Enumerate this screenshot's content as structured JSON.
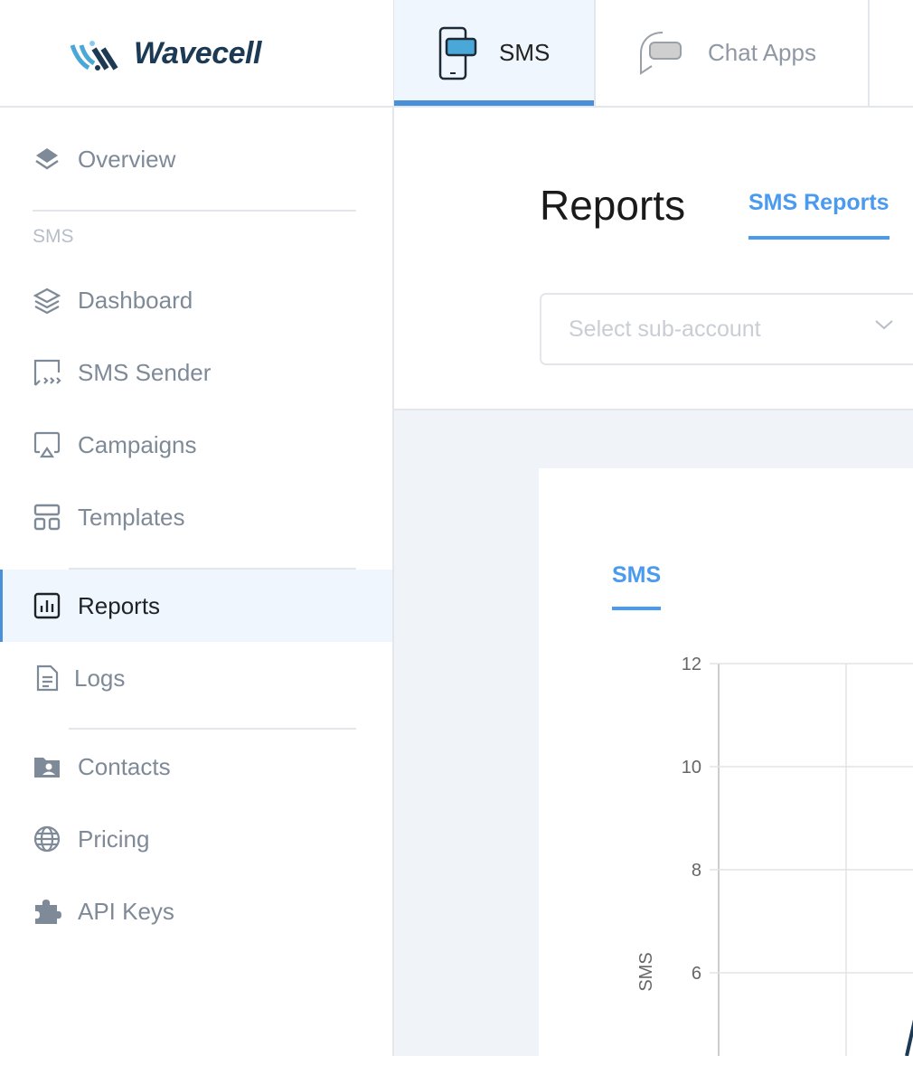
{
  "header": {
    "logo_text": "Wavecell",
    "tabs": [
      {
        "label": "SMS",
        "icon": "phone-message-icon",
        "active": true
      },
      {
        "label": "Chat Apps",
        "icon": "chat-bubbles-icon",
        "active": false
      }
    ]
  },
  "sidebar": {
    "overview": {
      "label": "Overview",
      "icon": "layers-solid-icon"
    },
    "section_label": "SMS",
    "items": [
      {
        "label": "Dashboard",
        "icon": "layers-icon"
      },
      {
        "label": "SMS Sender",
        "icon": "message-send-icon"
      },
      {
        "label": "Campaigns",
        "icon": "airplay-icon"
      },
      {
        "label": "Templates",
        "icon": "template-grid-icon"
      },
      {
        "label": "Reports",
        "icon": "bar-chart-icon",
        "active": true
      },
      {
        "label": "Logs",
        "icon": "document-icon"
      },
      {
        "label": "Contacts",
        "icon": "contacts-folder-icon"
      },
      {
        "label": "Pricing",
        "icon": "globe-icon"
      },
      {
        "label": "API Keys",
        "icon": "puzzle-icon"
      }
    ]
  },
  "main": {
    "title": "Reports",
    "subtab": "SMS Reports",
    "select_placeholder": "Select sub-account",
    "card_tab": "SMS"
  },
  "colors": {
    "accent": "#4a9af0",
    "active_bg": "#eff6fd",
    "brand_dark": "#1d3a55",
    "line": "#1d3a55"
  },
  "chart_data": {
    "type": "line",
    "ylabel": "SMS",
    "yticks": [
      12,
      10,
      8,
      6
    ],
    "grid": true
  }
}
